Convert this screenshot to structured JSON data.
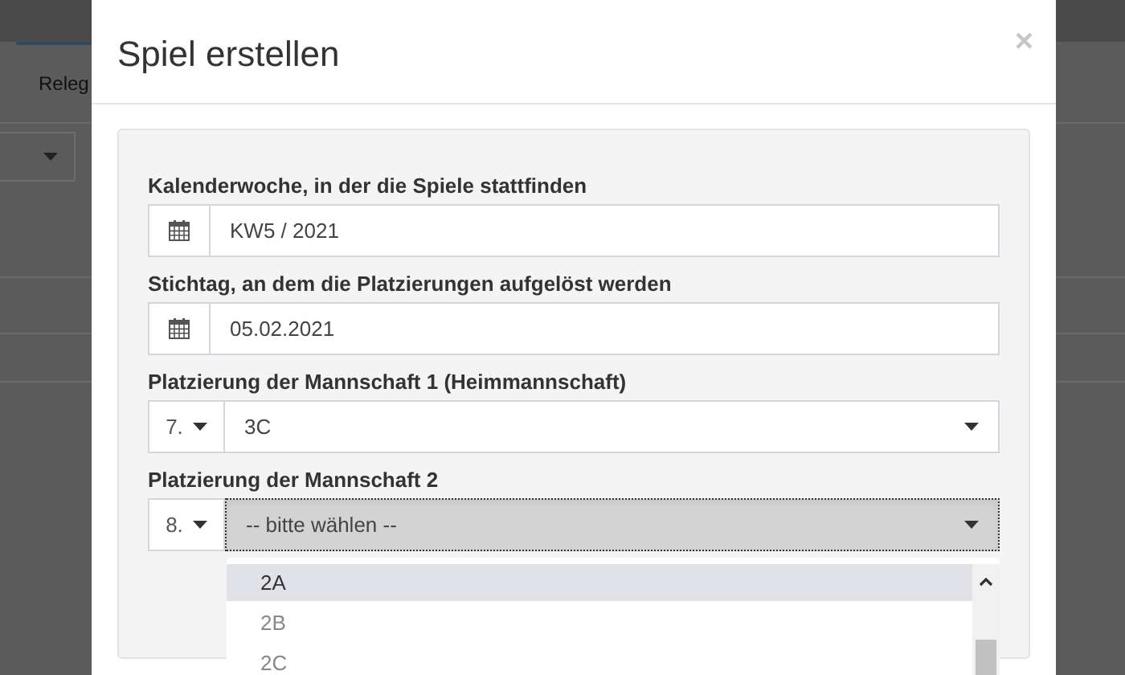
{
  "background": {
    "tab": "Releg"
  },
  "dialog": {
    "title": "Spiel erstellen",
    "close": "×",
    "fields": [
      {
        "kind": "date",
        "label": "Kalenderwoche, in der die Spiele stattfinden",
        "value": "KW5 / 2021"
      },
      {
        "kind": "date",
        "label": "Stichtag, an dem die Platzierungen aufgelöst werden",
        "value": "05.02.2021"
      },
      {
        "kind": "placement",
        "label": "Platzierung der Mannschaft 1 (Heimmannschaft)",
        "rank": "7.",
        "value": "3C",
        "focused": false
      },
      {
        "kind": "placement",
        "label": "Platzierung der Mannschaft 2",
        "rank": "8.",
        "value": "-- bitte wählen --",
        "focused": true
      }
    ],
    "dropdown": {
      "options": [
        {
          "label": "2A",
          "selected": true
        },
        {
          "label": "2B",
          "selected": false
        },
        {
          "label": "2C",
          "selected": false
        }
      ]
    }
  }
}
